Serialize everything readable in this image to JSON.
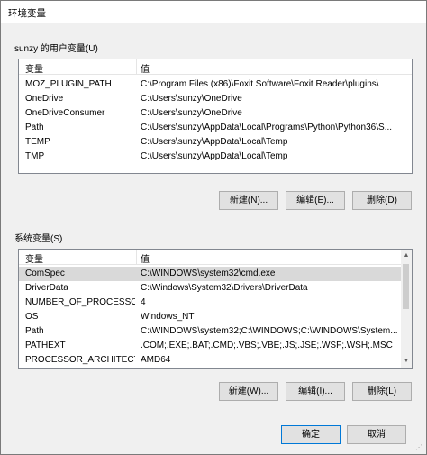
{
  "window": {
    "title": "环境变量"
  },
  "user_vars": {
    "label": "sunzy 的用户变量(U)",
    "columns": [
      "变量",
      "值"
    ],
    "rows": [
      {
        "name": "MOZ_PLUGIN_PATH",
        "value": "C:\\Program Files (x86)\\Foxit Software\\Foxit Reader\\plugins\\"
      },
      {
        "name": "OneDrive",
        "value": "C:\\Users\\sunzy\\OneDrive"
      },
      {
        "name": "OneDriveConsumer",
        "value": "C:\\Users\\sunzy\\OneDrive"
      },
      {
        "name": "Path",
        "value": "C:\\Users\\sunzy\\AppData\\Local\\Programs\\Python\\Python36\\S..."
      },
      {
        "name": "TEMP",
        "value": "C:\\Users\\sunzy\\AppData\\Local\\Temp"
      },
      {
        "name": "TMP",
        "value": "C:\\Users\\sunzy\\AppData\\Local\\Temp"
      }
    ],
    "buttons": {
      "new": "新建(N)...",
      "edit": "编辑(E)...",
      "delete": "删除(D)"
    }
  },
  "system_vars": {
    "label": "系统变量(S)",
    "columns": [
      "变量",
      "值"
    ],
    "selected_row": "ComSpec",
    "rows": [
      {
        "name": "ComSpec",
        "value": "C:\\WINDOWS\\system32\\cmd.exe"
      },
      {
        "name": "DriverData",
        "value": "C:\\Windows\\System32\\Drivers\\DriverData"
      },
      {
        "name": "NUMBER_OF_PROCESSORS",
        "value": "4"
      },
      {
        "name": "OS",
        "value": "Windows_NT"
      },
      {
        "name": "Path",
        "value": "C:\\WINDOWS\\system32;C:\\WINDOWS;C:\\WINDOWS\\System..."
      },
      {
        "name": "PATHEXT",
        "value": ".COM;.EXE;.BAT;.CMD;.VBS;.VBE;.JS;.JSE;.WSF;.WSH;.MSC"
      },
      {
        "name": "PROCESSOR_ARCHITECT...",
        "value": "AMD64"
      }
    ],
    "buttons": {
      "new": "新建(W)...",
      "edit": "编辑(I)...",
      "delete": "删除(L)"
    }
  },
  "footer": {
    "ok": "确定",
    "cancel": "取消"
  }
}
